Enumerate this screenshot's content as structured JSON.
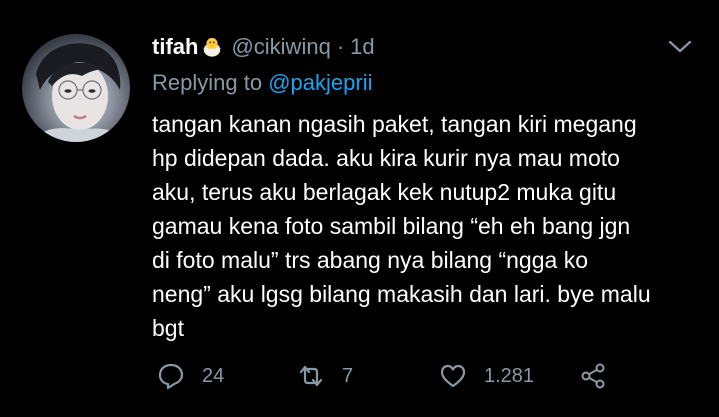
{
  "tweet": {
    "author_name": "tifah",
    "author_emoji": "hatching-chick-emoji",
    "handle": "@cikiwinq",
    "separator": "·",
    "time": "1d",
    "replying_prefix": "Replying to",
    "replying_to": "@pakjeprii",
    "text_lines": [
      "tangan kanan ngasih paket, tangan kiri megang",
      "hp didepan dada. aku kira kurir nya mau moto",
      "aku, terus aku berlagak kek nutup2 muka gitu",
      "gamau kena foto sambil bilang “eh eh bang jgn",
      "di foto malu” trs abang nya bilang “ngga ko",
      "neng” aku lgsg bilang makasih dan lari. bye malu",
      "bgt"
    ],
    "stats": {
      "replies": "24",
      "retweets": "7",
      "likes": "1.281"
    }
  },
  "icons": {
    "reply": "reply-icon",
    "retweet": "retweet-icon",
    "like": "heart-icon",
    "share": "share-icon",
    "more": "chevron-down-icon"
  },
  "colors": {
    "background": "#000000",
    "text": "#ffffff",
    "muted": "#8899a6",
    "mention": "#1da1f2"
  }
}
